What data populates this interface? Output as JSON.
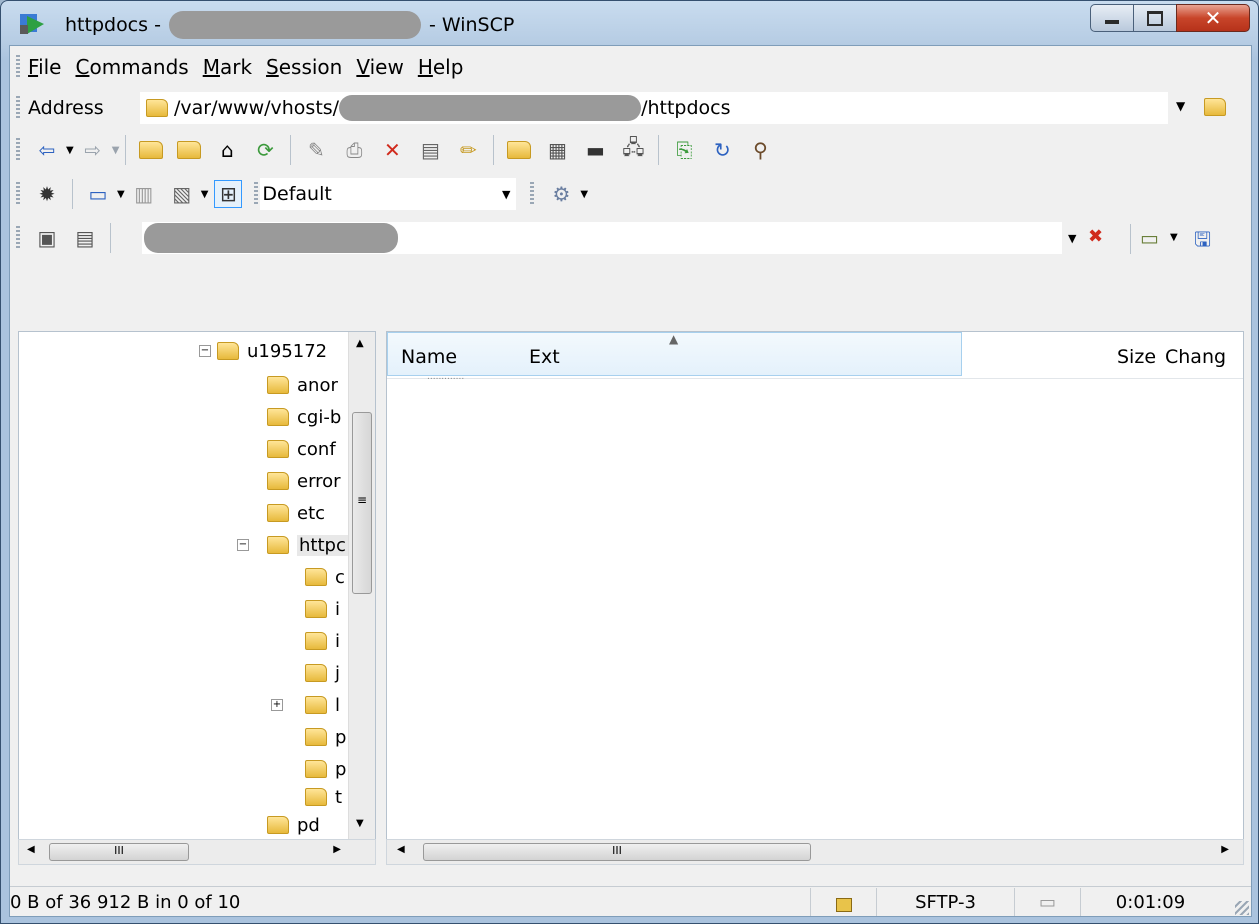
{
  "window": {
    "title_prefix": "httpdocs -",
    "title_suffix": "- WinSCP"
  },
  "menu": {
    "items": [
      {
        "accel": "F",
        "rest": "ile"
      },
      {
        "accel": "C",
        "rest": "ommands"
      },
      {
        "accel": "M",
        "rest": "ark"
      },
      {
        "accel": "S",
        "rest": "ession"
      },
      {
        "accel": "V",
        "rest": "iew"
      },
      {
        "accel": "H",
        "rest": "elp"
      }
    ]
  },
  "address": {
    "label": "Address",
    "path_start": "/var/www/vhosts/",
    "path_end": "/httpdocs"
  },
  "toolbar": {
    "filter_mask": "Default"
  },
  "tree": {
    "root": "u195172",
    "children": [
      "anor",
      "cgi-b",
      "conf",
      "error",
      "etc",
      "httpc"
    ],
    "sub": [
      "c",
      "i",
      "i",
      "j",
      "l",
      "p",
      "p",
      "t"
    ],
    "after": "pd"
  },
  "filelist": {
    "columns": {
      "name": "Name",
      "ext": "Ext",
      "size": "Size",
      "changed": "Chang"
    },
    "parent_row": "............."
  },
  "status": {
    "selection": "0 B of 36 912 B in 0 of 10",
    "protocol": "SFTP-3",
    "elapsed": "0:01:09"
  },
  "scroll_glyph": "III"
}
